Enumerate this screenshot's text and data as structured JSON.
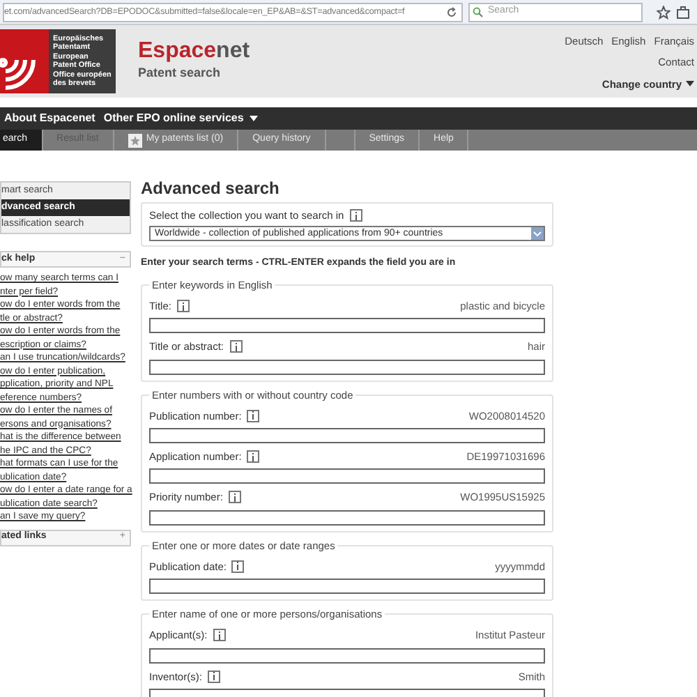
{
  "browser": {
    "url": "et.com/advancedSearch?DB=EPODOC&submitted=false&locale=en_EP&AB=&ST=advanced&compact=f",
    "search": {
      "placeholder": "Search"
    }
  },
  "header": {
    "logo_text": [
      "Europäisches Patentamt",
      "European Patent Office",
      "Office européen des brevets"
    ],
    "brand_first": "Espace",
    "brand_second": "net",
    "subtitle": "Patent search",
    "languages": [
      "Deutsch",
      "English",
      "Français"
    ],
    "contact": "Contact",
    "country": "Change country"
  },
  "nav": [
    "About Espacenet",
    "Other EPO online services"
  ],
  "tabs": [
    {
      "label": "earch",
      "selected": true,
      "disabled": false,
      "kind": "plain"
    },
    {
      "label": "Result list",
      "selected": false,
      "disabled": true,
      "kind": "plain"
    },
    {
      "label": "My patents list (0)",
      "selected": false,
      "disabled": false,
      "kind": "star"
    },
    {
      "label": "Query history",
      "selected": false,
      "disabled": false,
      "kind": "plain"
    },
    {
      "label": "Settings",
      "selected": false,
      "disabled": false,
      "kind": "plain"
    },
    {
      "label": "Help",
      "selected": false,
      "disabled": false,
      "kind": "plain"
    }
  ],
  "sidebar": {
    "items": [
      {
        "label": "mart search",
        "selected": false
      },
      {
        "label": "dvanced search",
        "selected": true
      },
      {
        "label": "lassification search",
        "selected": false
      }
    ],
    "quick_help": {
      "title": "ck help",
      "toggle": "−",
      "expanded": true,
      "links": [
        {
          "lines": [
            "ow many search terms can I",
            "nter per field?"
          ]
        },
        {
          "lines": [
            "ow do I enter words from the",
            "tle or abstract?"
          ]
        },
        {
          "lines": [
            "ow do I enter words from the",
            "escription or claims?"
          ]
        },
        {
          "lines": [
            "an I use truncation/wildcards?"
          ]
        },
        {
          "lines": [
            "ow do I enter publication,",
            "pplication, priority and NPL",
            "eference numbers?"
          ]
        },
        {
          "lines": [
            "ow do I enter the names of",
            "ersons and organisations?"
          ]
        },
        {
          "lines": [
            "hat is the difference between",
            "he IPC and the CPC?"
          ]
        },
        {
          "lines": [
            "hat formats can I use for the",
            "ublication date?"
          ]
        },
        {
          "lines": [
            "ow do I enter a date range for a",
            "ublication date search?"
          ]
        },
        {
          "lines": [
            "an I save my query?"
          ]
        }
      ]
    },
    "related_links": {
      "title": "ated links",
      "toggle": "+",
      "expanded": false
    }
  },
  "main": {
    "title": "Advanced search",
    "collection_label": "Select the collection you want to search in",
    "collection_value": "Worldwide - collection of published applications from 90+ countries",
    "instructions": "Enter your search terms - CTRL-ENTER expands the field you are in",
    "fieldsets": [
      {
        "legend": "Enter keywords in English",
        "fields": [
          {
            "label": "Title:",
            "example": "plastic and bicycle"
          },
          {
            "label": "Title or abstract:",
            "example": "hair"
          }
        ]
      },
      {
        "legend": "Enter numbers with or without country code",
        "fields": [
          {
            "label": "Publication number:",
            "example": "WO2008014520"
          },
          {
            "label": "Application number:",
            "example": "DE19971031696"
          },
          {
            "label": "Priority number:",
            "example": "WO1995US15925"
          }
        ]
      },
      {
        "legend": "Enter one or more dates or date ranges",
        "fields": [
          {
            "label": "Publication date:",
            "example": "yyyymmdd"
          }
        ]
      },
      {
        "legend": "Enter name of one or more persons/organisations",
        "fields": [
          {
            "label": "Applicant(s):",
            "example": "Institut Pasteur"
          },
          {
            "label": "Inventor(s):",
            "example": "Smith"
          }
        ]
      }
    ]
  }
}
